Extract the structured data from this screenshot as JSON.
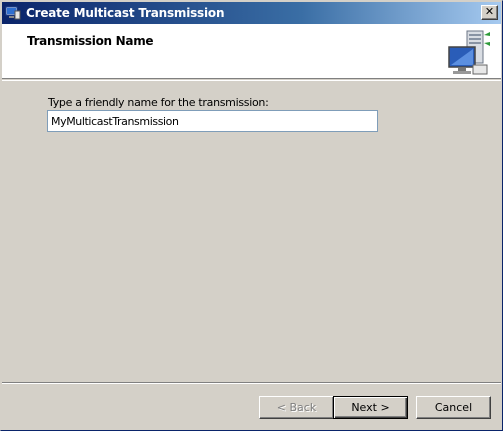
{
  "window": {
    "title": "Create Multicast Transmission",
    "close_glyph": "✕",
    "app_icon": "multicast-app-icon"
  },
  "header": {
    "title": "Transmission Name",
    "icon": "server-computer-icon"
  },
  "form": {
    "prompt_label": "Type a friendly name for the transmission:",
    "name_value": "MyMulticastTransmission"
  },
  "buttons": {
    "back": "< Back",
    "next": "Next >",
    "cancel": "Cancel"
  },
  "colors": {
    "titlebar_start": "#0a246a",
    "titlebar_end": "#a6caf0",
    "dialog_bg": "#d4d0c8"
  }
}
